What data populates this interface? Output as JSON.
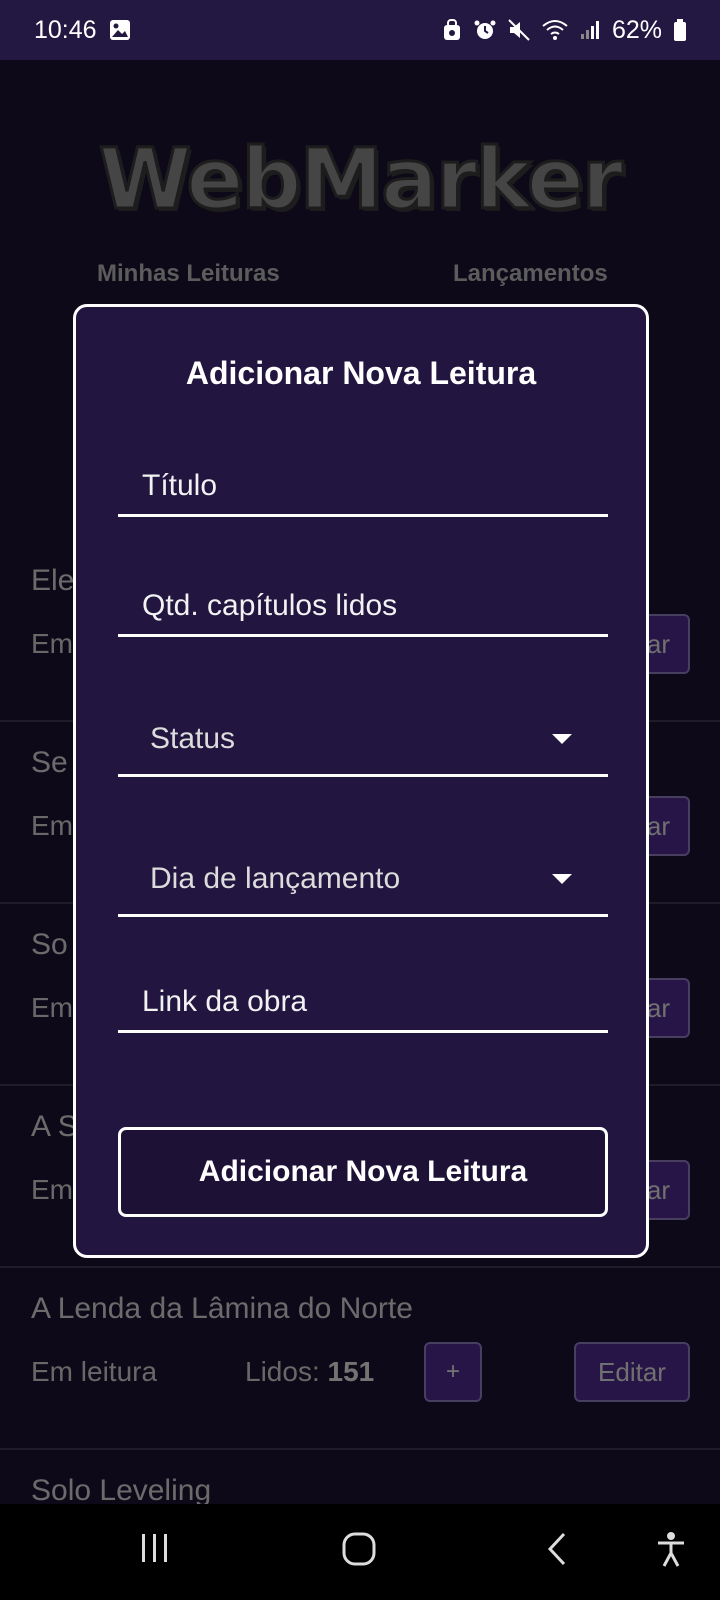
{
  "status_bar": {
    "time": "10:46",
    "battery": "62%"
  },
  "app": {
    "logo": "WebMarker",
    "nav": {
      "minhas_leituras": "Minhas Leituras",
      "lancamentos": "Lançamentos"
    },
    "list": [
      {
        "title": "Ele",
        "status": "Em",
        "edit": "ar"
      },
      {
        "title": "Se",
        "status": "Em",
        "edit": "ar"
      },
      {
        "title": "So",
        "status": "Em",
        "edit": "ar"
      },
      {
        "title": "A S",
        "status": "Em",
        "edit": "ar"
      },
      {
        "title": "A Lenda da Lâmina do Norte",
        "status": "Em leitura",
        "lidos_label": "Lidos: ",
        "lidos_value": "151",
        "plus": "+",
        "edit": "Editar"
      },
      {
        "title": "Solo Leveling"
      }
    ]
  },
  "modal": {
    "title": "Adicionar Nova Leitura",
    "fields": {
      "titulo_placeholder": "Título",
      "capitulos_placeholder": "Qtd. capítulos lidos",
      "status_value": "Status",
      "dia_value": "Dia de lançamento",
      "link_placeholder": "Link da obra"
    },
    "submit_label": "Adicionar Nova Leitura"
  },
  "icons": {
    "gallery": "image-icon",
    "nav_recent": "recent-apps-icon",
    "nav_home": "home-icon",
    "nav_back": "back-icon",
    "nav_accessibility": "accessibility-icon"
  },
  "colors": {
    "accent_purple": "#4e2a8f",
    "modal_bg": "#221640",
    "status_bar": "#231842"
  }
}
